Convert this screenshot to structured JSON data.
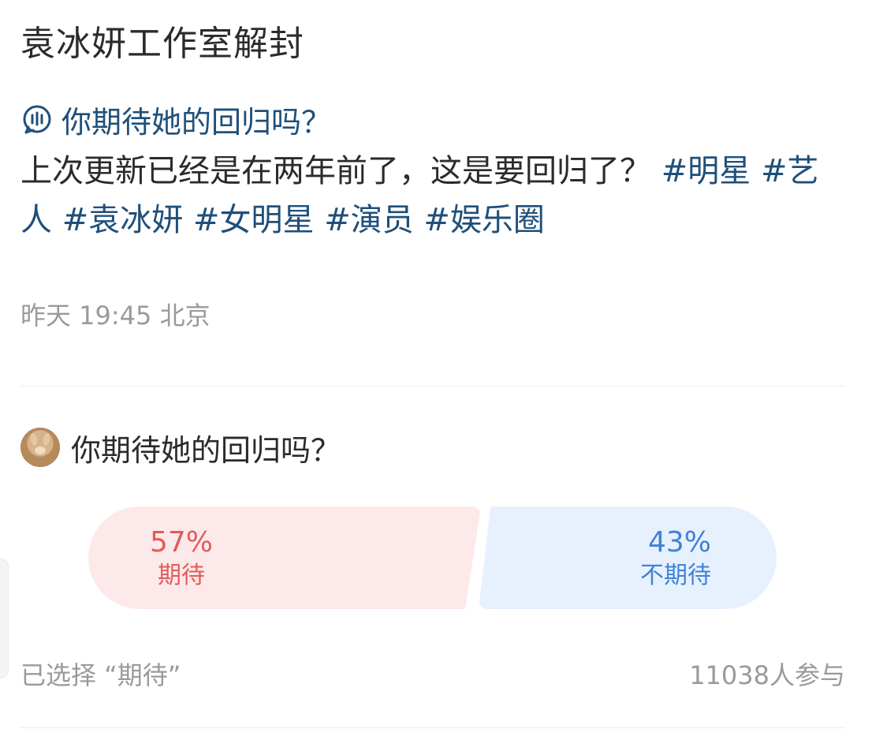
{
  "post": {
    "title": "袁冰妍工作室解封",
    "topic": "你期待她的回归吗？",
    "body": "上次更新已经是在两年前了，这是要回归了？",
    "tags": [
      "#明星",
      "#艺人",
      "#袁冰妍",
      "#女明星",
      "#演员",
      "#娱乐圈"
    ],
    "time": "昨天 19:45",
    "location": "北京"
  },
  "poll": {
    "question": "你期待她的回归吗？",
    "options": [
      {
        "percent": "57%",
        "label": "期待",
        "value": 57,
        "color": "#e25b5b",
        "background": "#fde9e9"
      },
      {
        "percent": "43%",
        "label": "不期待",
        "value": 43,
        "color": "#3f82d6",
        "background": "#e7f1fe"
      }
    ],
    "selected_text": "已选择 “期待”",
    "participants": "11038人参与"
  },
  "icons": {
    "topic": "chat-bubble-icon",
    "avatar": "rabbit-avatar"
  }
}
